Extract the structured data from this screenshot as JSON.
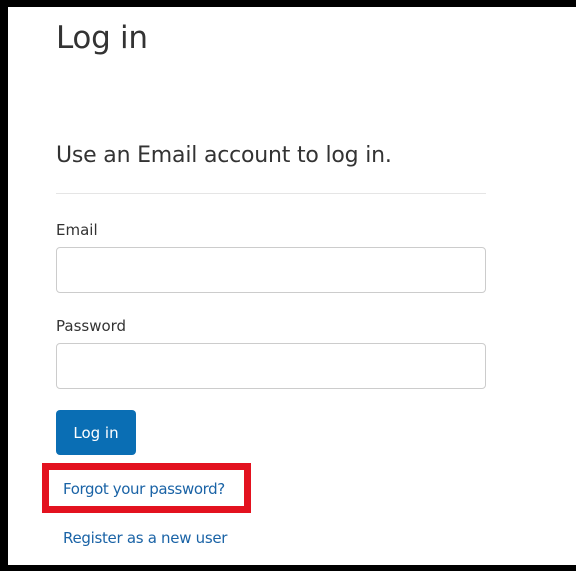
{
  "page": {
    "title": "Log in"
  },
  "login_form": {
    "section_title": "Use an Email account to log in.",
    "email": {
      "label": "Email",
      "value": "",
      "placeholder": ""
    },
    "password": {
      "label": "Password",
      "value": "",
      "placeholder": ""
    },
    "submit_label": "Log in"
  },
  "links": {
    "forgot_password": "Forgot your password?",
    "register": "Register as a new user"
  },
  "colors": {
    "button_background": "#0a6eb4",
    "link": "#1a63a6",
    "highlight": "#e3121f"
  }
}
